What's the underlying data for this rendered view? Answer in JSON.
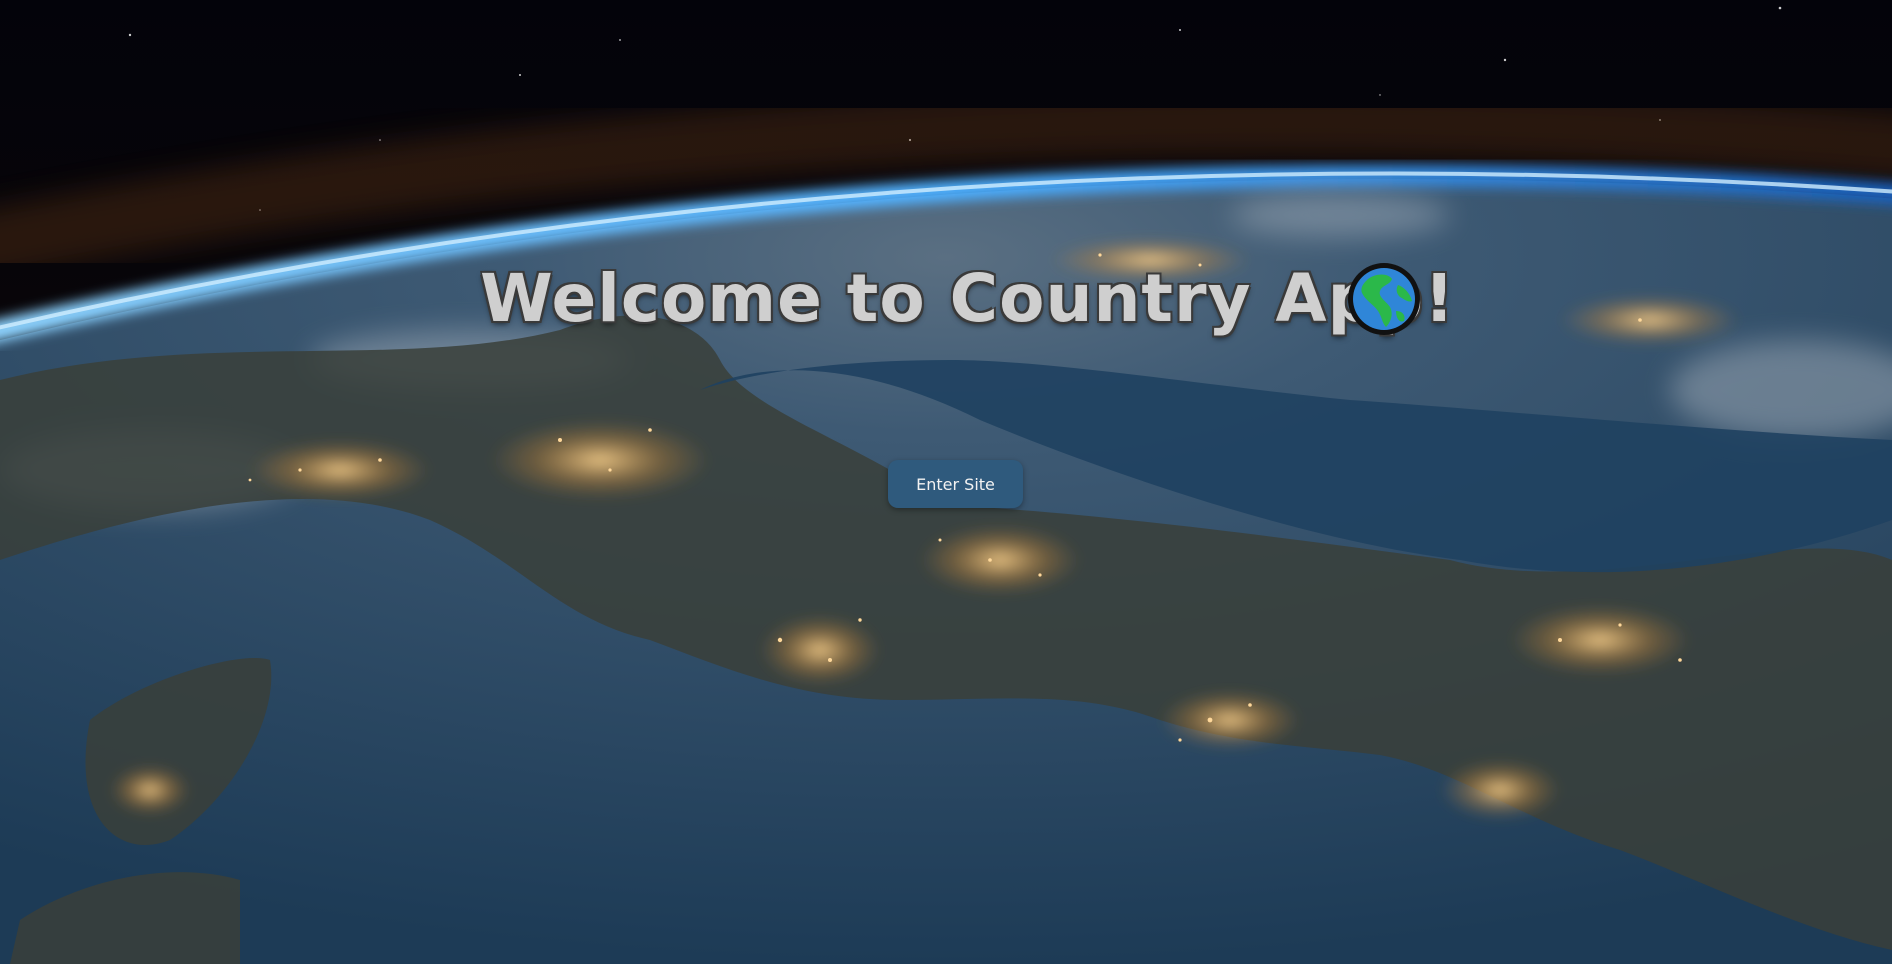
{
  "hero": {
    "title": "Welcome to Country App!",
    "title_icon": "globe-americas-icon",
    "enter_button_label": "Enter Site",
    "background": "earth-at-night-from-orbit"
  },
  "colors": {
    "title_text": "#cfcfcf",
    "title_outline": "#3a3a3a",
    "button_bg": "#2f5a7d",
    "button_text": "#f2f2f2",
    "space": "#05050a",
    "atmosphere": "#3aa0ff",
    "ocean": "#1f3d57",
    "city_lights": "#ffcf80"
  }
}
